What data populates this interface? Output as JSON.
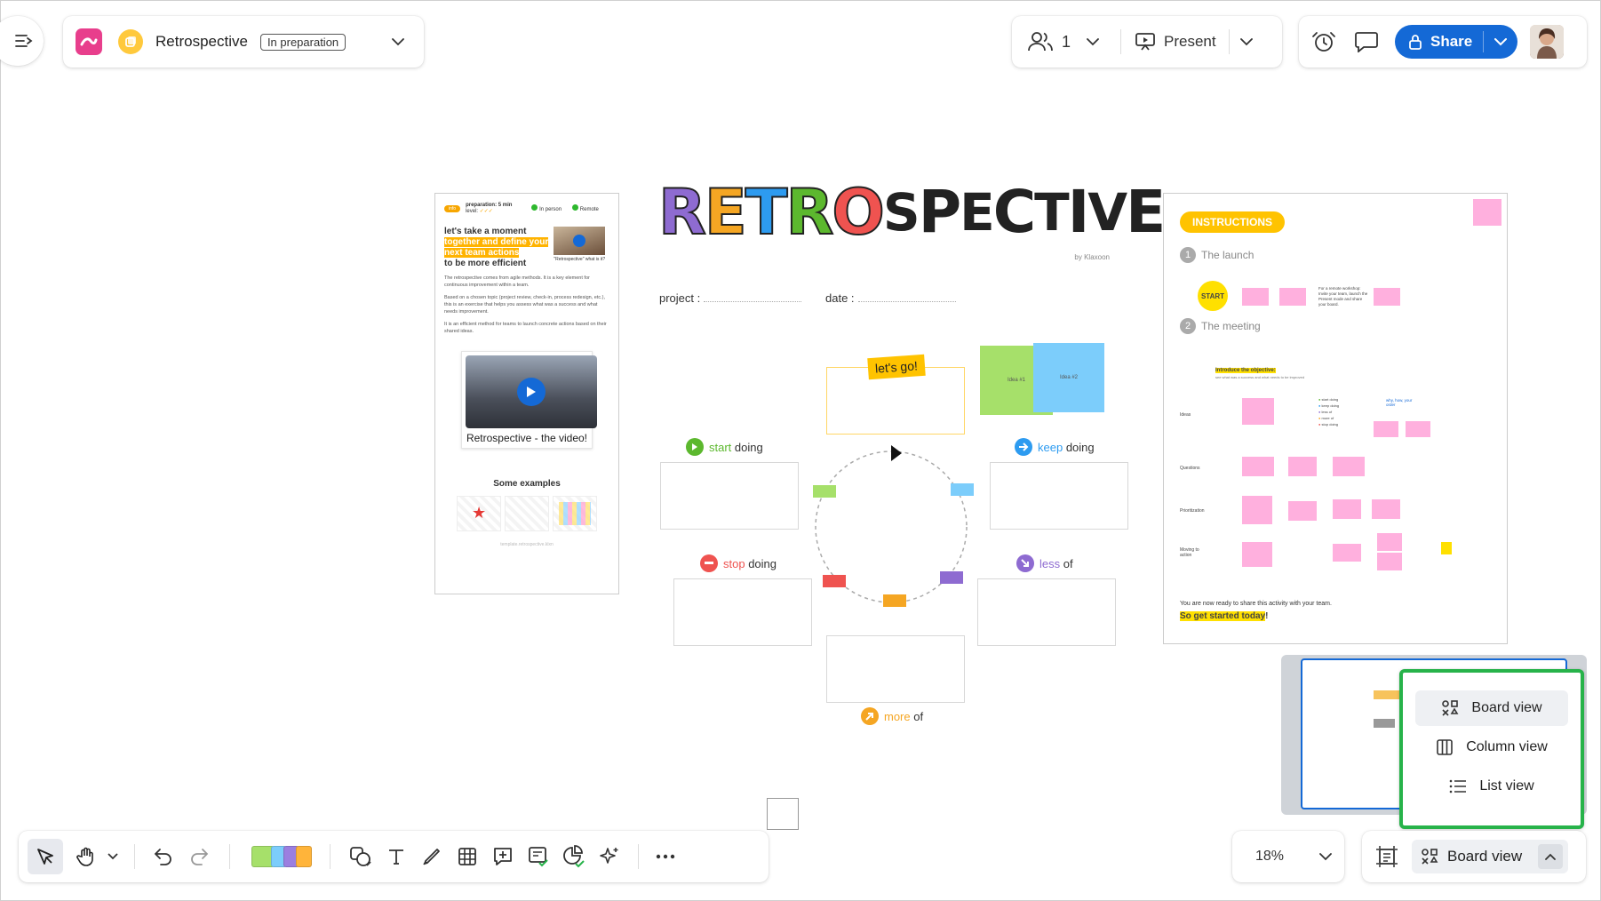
{
  "header": {
    "board_title": "Retrospective",
    "status_tag": "In preparation",
    "collaborators_count": "1",
    "present_label": "Present",
    "share_label": "Share"
  },
  "canvas": {
    "left_card": {
      "prep": "preparation: 5 min",
      "level": "level:",
      "in_person": "In person",
      "remote": "Remote",
      "info_tag": "info",
      "headline_1": "let's take a moment",
      "headline_2": "together and define your",
      "headline_3": "next team actions",
      "headline_4": "to be more efficient",
      "thumb_caption": "\"Retrospective\" what is it?",
      "para_1": "The retrospective comes from agile methods. It is a key element for continuous improvement within a team.",
      "para_2": "Based on a chosen topic (project review, check-in, process redesign, etc.), this is an exercise that helps you assess what was a success and what needs improvement.",
      "para_3": "It is an efficient method for teams to launch concrete actions based on their shared ideas.",
      "video_caption": "Retrospective - the video!",
      "examples_title": "Some examples",
      "footer": "template.retrospective.klxn"
    },
    "logo_text": [
      "R",
      "E",
      "T",
      "R",
      "O",
      "S",
      "P",
      "E",
      "C",
      "T",
      "I",
      "V",
      "E"
    ],
    "logo_by": "by Klaxoon",
    "project_label": "project :",
    "date_label": "date :",
    "lets_go": "let's go!",
    "idea_1": "Idea #1",
    "idea_2": "Idea #2",
    "quadrants": {
      "start": {
        "accent": "start",
        "rest": "doing"
      },
      "keep": {
        "accent": "keep",
        "rest": "doing"
      },
      "stop": {
        "accent": "stop",
        "rest": "doing"
      },
      "less": {
        "accent": "less",
        "rest": "of"
      },
      "more": {
        "accent": "more",
        "rest": "of"
      }
    },
    "right_card": {
      "title": "INSTRUCTIONS",
      "step_1_num": "1",
      "step_1": "The launch",
      "start_badge": "START",
      "launch_note": "For a remote workshop: Invite your team, launch the Present mode and share your board.",
      "step_2_num": "2",
      "step_2": "The meeting",
      "objective": "Introduce the objective:",
      "objective_sub": "see what was a success and what needs to be improved",
      "why_how": "why, how, your order",
      "legend_items": [
        "start doing",
        "keep doing",
        "less of",
        "more of",
        "stop doing"
      ],
      "rows": [
        "Ideas",
        "Questions",
        "Prioritization",
        "Moving to action"
      ],
      "ready": "You are now ready to share this activity with your team.",
      "cta": "So get started today",
      "cta_end": "!"
    }
  },
  "view_menu": {
    "items": [
      {
        "label": "Board view",
        "icon": "board-view-icon",
        "active": true
      },
      {
        "label": "Column view",
        "icon": "column-view-icon",
        "active": false
      },
      {
        "label": "List view",
        "icon": "list-view-icon",
        "active": false
      }
    ]
  },
  "zoom": {
    "value": "18%"
  },
  "view_switcher": {
    "label": "Board view"
  },
  "colors": {
    "accent_blue": "#1469d6",
    "green_highlight": "#27b34a",
    "yellow": "#ffc300",
    "pink": "#e83e8c",
    "start": "#5cb82e",
    "keep": "#2d9bf0",
    "stop": "#ef5350",
    "less": "#8e6bd1",
    "more": "#f5a623"
  }
}
